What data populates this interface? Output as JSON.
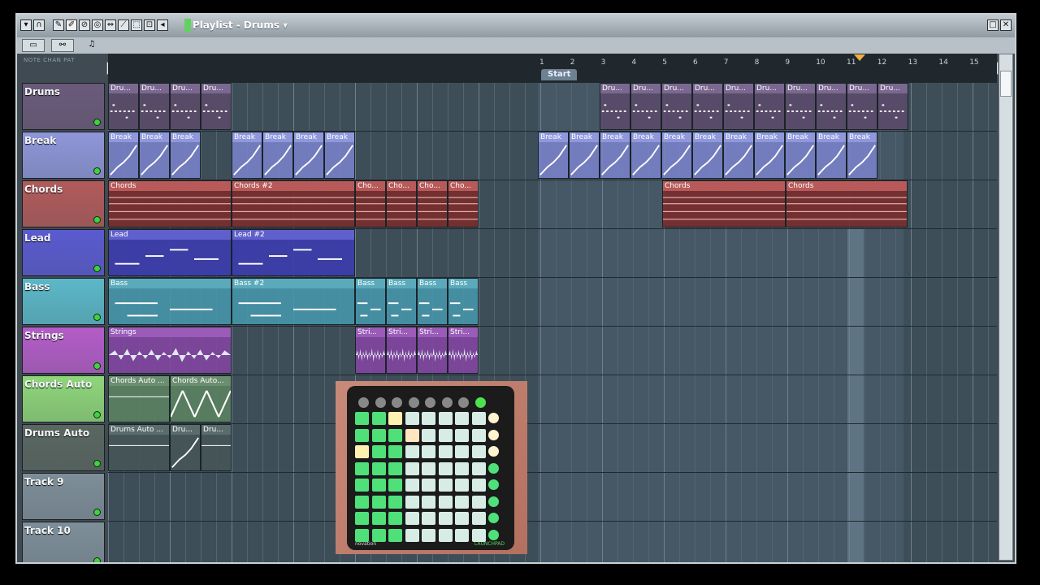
{
  "window": {
    "title_prefix": "Playlist",
    "title_separator": " - ",
    "title_name": "Drums",
    "controls": [
      "▾",
      "∩"
    ],
    "window_buttons": [
      "□",
      "✕"
    ],
    "sub_label": "NOTE  CHAN  PAT"
  },
  "ruler": {
    "bars": [
      "1",
      "2",
      "3",
      "4",
      "5",
      "6",
      "7",
      "8",
      "9",
      "10",
      "11",
      "12",
      "13",
      "14",
      "15"
    ],
    "start_marker": "Start"
  },
  "tracks": [
    {
      "name": "Drums",
      "color": "#6a5a7a"
    },
    {
      "name": "Break",
      "color": "#8f96d9"
    },
    {
      "name": "Chords",
      "color": "#b25a5a"
    },
    {
      "name": "Lead",
      "color": "#5a5ad0"
    },
    {
      "name": "Bass",
      "color": "#5bb8c8"
    },
    {
      "name": "Strings",
      "color": "#b45cc8"
    },
    {
      "name": "Chords Auto",
      "color": "#8fd67a"
    },
    {
      "name": "Drums Auto",
      "color": "#5a6660"
    },
    {
      "name": "Track 9",
      "color": "#7e8e98"
    },
    {
      "name": "Track 10",
      "color": "#7e8e98"
    }
  ],
  "clips": {
    "drums": [
      "Dru...",
      "Dru...",
      "Dru...",
      "Dru...",
      "Dru...",
      "Dru...",
      "Dru...",
      "Dru...",
      "Dru...",
      "Dru...",
      "Dru...",
      "Dru...",
      "Dru...",
      "Dru..."
    ],
    "break": [
      "Break",
      "Break",
      "Break",
      "Break",
      "Break",
      "Break",
      "Break",
      "Break",
      "Break",
      "Break",
      "Break",
      "Break",
      "Break",
      "Break",
      "Break",
      "Break",
      "Break",
      "Break"
    ],
    "chords": [
      "Chords",
      "Chords #2",
      "Cho...",
      "Cho...",
      "Cho...",
      "Cho...",
      "Chords",
      "Chords"
    ],
    "lead": [
      "Lead",
      "Lead #2"
    ],
    "bass": [
      "Bass",
      "Bass #2",
      "Bass",
      "Bass",
      "Bass",
      "Bass"
    ],
    "strings": [
      "Strings",
      "Stri...",
      "Stri...",
      "Stri...",
      "Stri..."
    ],
    "chords_auto": [
      "Chords Auto ...",
      "Chords Auto..."
    ],
    "drums_auto": [
      "Drums Auto ...",
      "Dru...",
      "Dru..."
    ]
  },
  "launchpad": {
    "brand": "novation",
    "model": "LAUNCHPAD"
  },
  "colors": {
    "accent_green": "#5fd35f",
    "playhead": "#f0b040"
  }
}
